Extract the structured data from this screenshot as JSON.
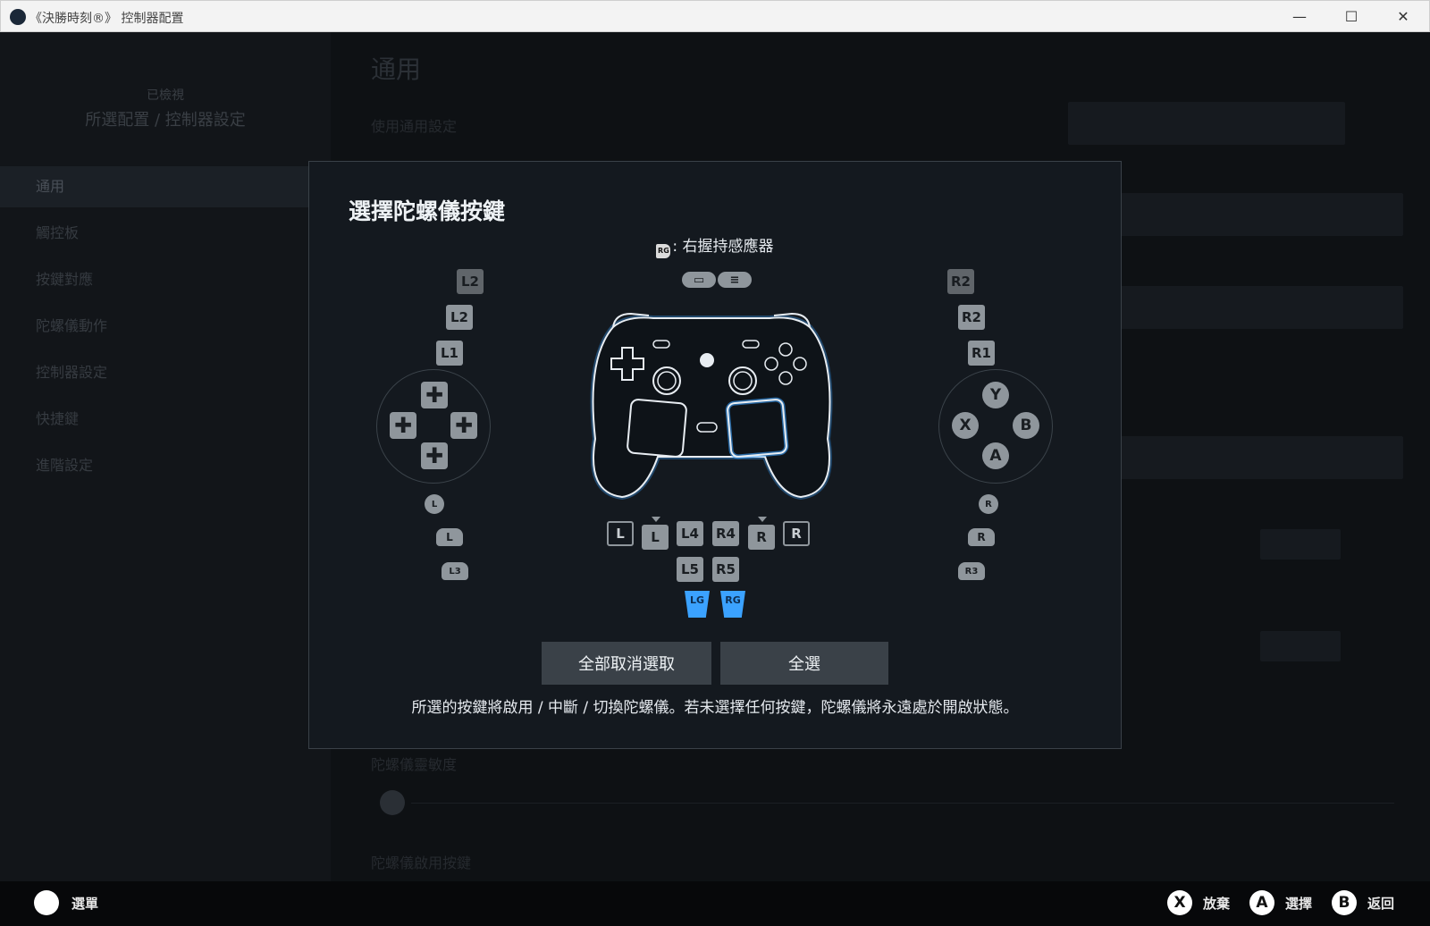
{
  "window": {
    "title": "《決勝時刻®》 控制器配置",
    "controls": [
      "—",
      "☐",
      "✕"
    ]
  },
  "sidebar": {
    "header_line1": "已檢視",
    "header_line2": "所選配置 / 控制器設定",
    "items": [
      "通用",
      "觸控板",
      "按鍵對應",
      "陀螺儀動作",
      "控制器設定",
      "快捷鍵",
      "進階設定"
    ]
  },
  "background": {
    "section_title": "通用",
    "rows": [
      "使用通用設定",
      "陀螺儀靈敏度",
      "陀螺儀啟用按鍵"
    ]
  },
  "dialog": {
    "title": "選擇陀螺儀按鍵",
    "legend_icon": "RG",
    "legend_text": ": 右握持感應器",
    "left": {
      "l2_full": "L2",
      "l2": "L2",
      "l1": "L1",
      "stick_l": "L",
      "grip_l": "L",
      "l3": "L3"
    },
    "right": {
      "r2_full": "R2",
      "r2": "R2",
      "r1": "R1",
      "face": [
        "Y",
        "X",
        "B",
        "A"
      ],
      "stick_r": "R",
      "grip_r": "R",
      "r3": "R3"
    },
    "center_row": [
      "L",
      "L",
      "L4",
      "R4",
      "R",
      "R"
    ],
    "center_row2": [
      "L5",
      "R5"
    ],
    "gyro_buttons": [
      "LG",
      "RG"
    ],
    "deselect_all": "全部取消選取",
    "select_all": "全選",
    "note": "所選的按鍵將啟用 / 中斷 / 切換陀螺儀。若未選擇任何按鍵，陀螺儀將永遠處於開啟狀態。"
  },
  "bottom_bar": {
    "menu_label": "選單",
    "actions": [
      {
        "key": "X",
        "label": "放棄"
      },
      {
        "key": "A",
        "label": "選擇"
      },
      {
        "key": "B",
        "label": "返回"
      }
    ]
  }
}
